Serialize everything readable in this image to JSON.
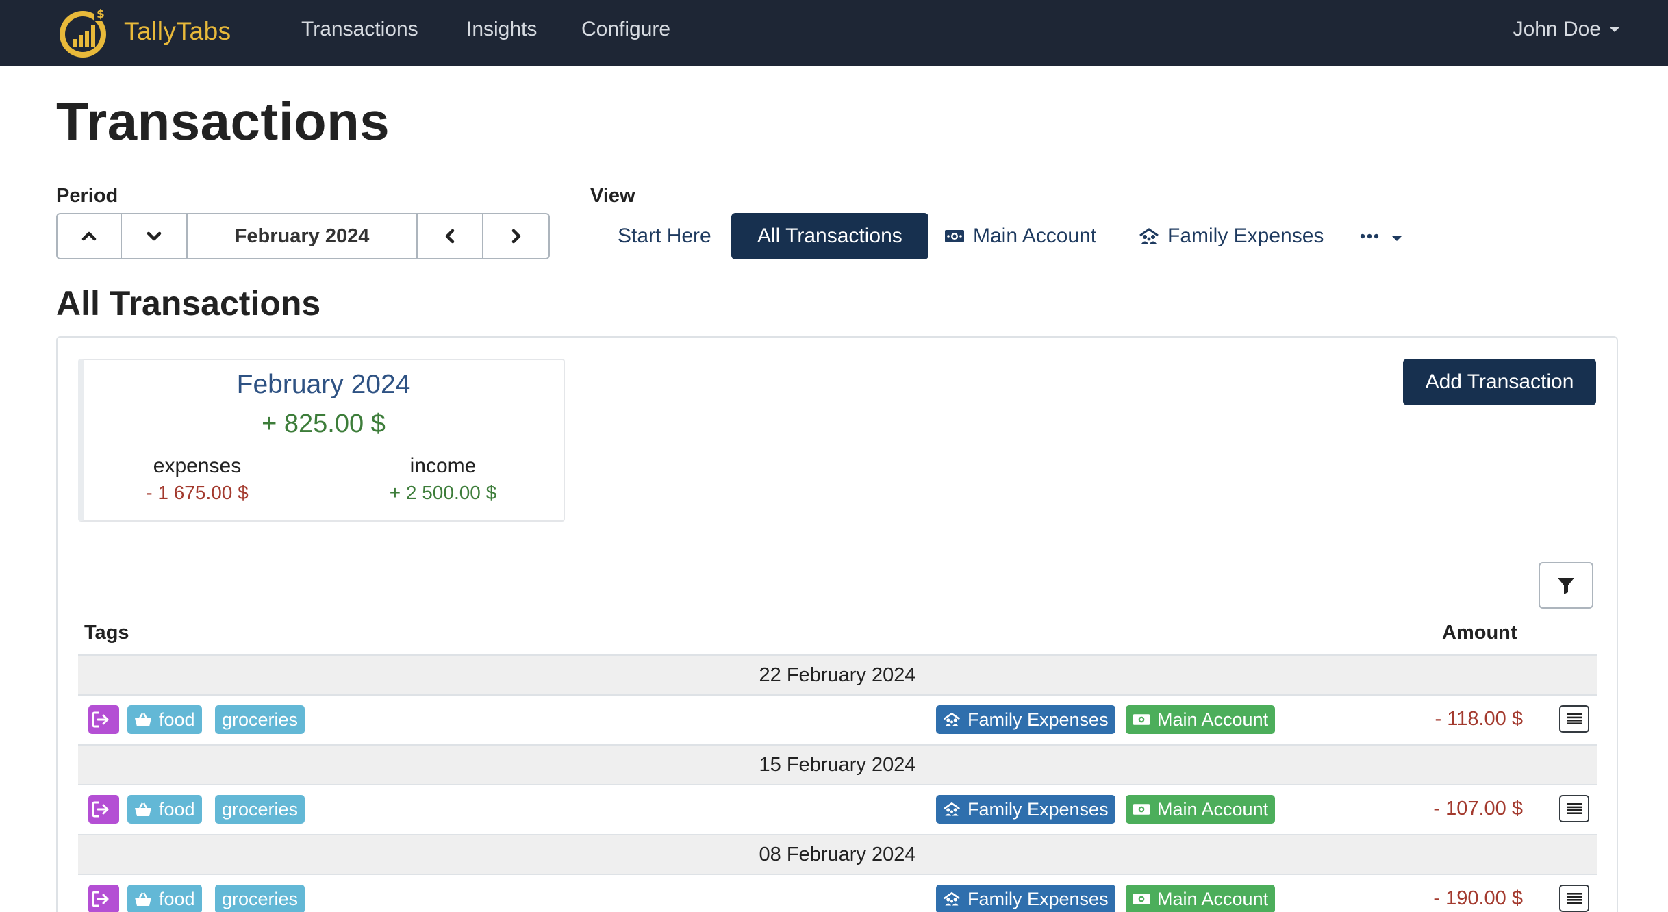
{
  "navbar": {
    "brand": "TallyTabs",
    "links": [
      "Transactions",
      "Insights",
      "Configure"
    ],
    "user": "John Doe",
    "colors": {
      "background": "#1e2635",
      "brand": "#e8b93a"
    }
  },
  "page": {
    "title": "Transactions"
  },
  "period": {
    "label": "Period",
    "current": "February 2024"
  },
  "view": {
    "label": "View",
    "tabs": [
      {
        "label": "Start Here",
        "icon": ""
      },
      {
        "label": "All Transactions",
        "icon": "",
        "active": true
      },
      {
        "label": "Main Account",
        "icon": "money-icon"
      },
      {
        "label": "Family Expenses",
        "icon": "family-icon"
      }
    ],
    "more_icon": "more-dots-icon"
  },
  "section": {
    "title": "All Transactions"
  },
  "summary": {
    "month": "February 2024",
    "total": "+ 825.00 $",
    "expenses_label": "expenses",
    "expenses_value": "- 1 675.00 $",
    "income_label": "income",
    "income_value": "+ 2 500.00 $"
  },
  "actions": {
    "add_transaction": "Add Transaction"
  },
  "table": {
    "headers": {
      "tags": "Tags",
      "amount": "Amount"
    },
    "groups": [
      {
        "date": "22 February 2024",
        "rows": [
          {
            "tags": [
              "food",
              "groceries"
            ],
            "accounts": [
              "Family Expenses",
              "Main Account"
            ],
            "amount": "- 118.00 $"
          }
        ]
      },
      {
        "date": "15 February 2024",
        "rows": [
          {
            "tags": [
              "food",
              "groceries"
            ],
            "accounts": [
              "Family Expenses",
              "Main Account"
            ],
            "amount": "- 107.00 $"
          }
        ]
      },
      {
        "date": "08 February 2024",
        "rows": [
          {
            "tags": [
              "food",
              "groceries"
            ],
            "accounts": [
              "Family Expenses",
              "Main Account"
            ],
            "amount": "- 190.00 $"
          }
        ]
      }
    ]
  }
}
